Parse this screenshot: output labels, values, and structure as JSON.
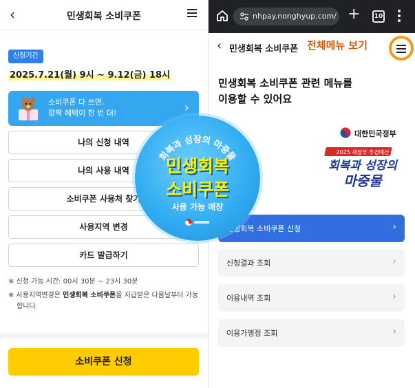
{
  "left": {
    "header": {
      "back_icon": "chevron-left-icon",
      "title": "민생회복 소비쿠폰",
      "menu_icon": "hamburger-icon"
    },
    "badge": "신청기간",
    "period": "2025.7.21(월) 9시 ~ 9.12(금) 18시",
    "banner": {
      "line1": "소비쿠폰 다 쓰면,",
      "line2": "깜짝 혜택이 한 번 더!",
      "arrow": "›",
      "color": "#35a7f0"
    },
    "buttons": [
      "나의 신청 내역",
      "나의 사용 내역",
      "소비쿠폰 사용처 찾기",
      "사용지역 변경",
      "카드 발급하기"
    ],
    "notes": {
      "hours": "※ 신청 가능 시간: 00시 30분 ~ 23시 30분",
      "region_prefix": "※ 사용지역변경은 ",
      "region_bold": "민생회복 소비쿠폰",
      "region_suffix": "을 지급받은 다음날부터 가능합니다."
    },
    "apply_button": "소비쿠폰 신청",
    "apply_color": "#ffcc00"
  },
  "right": {
    "browser": {
      "url": "nhpay.nonghyup.com/v",
      "tab_count": "10",
      "icons": [
        "home-icon",
        "site-settings-icon",
        "plus-icon",
        "tabs-icon",
        "kebab-menu-icon"
      ]
    },
    "header": {
      "back_icon": "chevron-left-icon",
      "title": "민생회복 소비쿠폰",
      "annotation": "전체메뉴 보기",
      "menu_icon": "hamburger-icon"
    },
    "heading_line1": "민생회복 소비쿠폰 관련 메뉴를",
    "heading_line2": "이용할 수 있어요",
    "gov_logo_text": "대한민국정부",
    "brand": {
      "small": "2025 새정부 추경예산",
      "line1": "회복과 성장의",
      "line2": "마중물"
    },
    "menu_items": [
      {
        "label": "민생회복 소비쿠폰 신청",
        "primary": true
      },
      {
        "label": "신청결과 조회",
        "primary": false
      },
      {
        "label": "이용내역 조회",
        "primary": false
      },
      {
        "label": "이용가맹점 조회",
        "primary": false
      }
    ],
    "primary_color": "#2f6fe0"
  },
  "overlay": {
    "arc_text": "회복과 성장의 마중물",
    "line1": "민생회복",
    "line2": "소비쿠폰",
    "sub": "사용 가능 매장",
    "seal": "행정안전부"
  }
}
